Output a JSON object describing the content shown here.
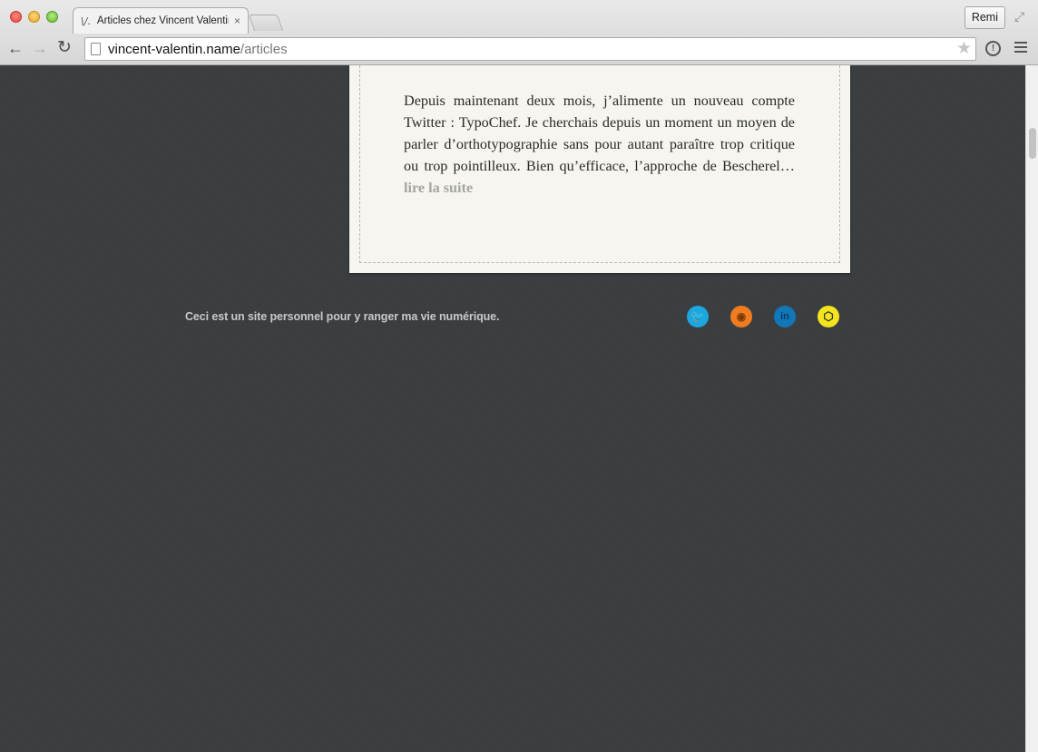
{
  "browser": {
    "tab_title": "Articles chez Vincent Valentin",
    "tab_favicon": "\\/.",
    "tab_close": "×",
    "profile_name": "Remi",
    "url_host": "vincent-valentin.name",
    "url_path": "/articles",
    "icons": {
      "back": "←",
      "forward": "→",
      "reload": "↻",
      "star": "★",
      "info": "!",
      "fullscreen": "⤢"
    }
  },
  "article": {
    "excerpt": "Depuis maintenant deux mois, j’alimente un nouveau compte Twitter : TypoChef. Je cherchais depuis un moment un moyen de parler d’orthotypographie sans pour autant paraître trop critique ou trop pointilleux. Bien qu’efficace, l’approche de Bescherel…",
    "read_more": "lire la suite"
  },
  "footer": {
    "tagline": "Ceci est un site personnel pour y ranger ma vie numérique.",
    "social": [
      {
        "name": "twitter",
        "glyph": "🐦",
        "color": "#1ca7de"
      },
      {
        "name": "rss",
        "glyph": "◉",
        "color": "#f07c1f"
      },
      {
        "name": "linkedin",
        "glyph": "in",
        "color": "#1177b8"
      },
      {
        "name": "codepen",
        "glyph": "⬡",
        "color": "#f4e41d"
      }
    ]
  }
}
